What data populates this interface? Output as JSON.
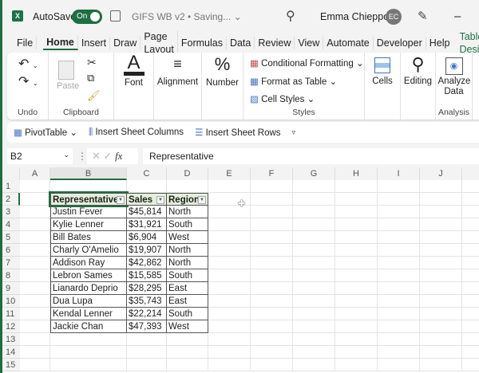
{
  "title": {
    "autosave": "AutoSave",
    "toggle": "On",
    "doc": "GIFS WB v2 • Saving... ⌄",
    "user": "Emma Chieppor",
    "initials": "EC"
  },
  "tabs": [
    "File",
    "Home",
    "Insert",
    "Draw",
    "Page Layout",
    "Formulas",
    "Data",
    "Review",
    "View",
    "Automate",
    "Developer",
    "Help",
    "Table Design"
  ],
  "ribbon": {
    "undo": "Undo",
    "paste": "Paste",
    "clipboard": "Clipboard",
    "font": "Font",
    "alignment": "Alignment",
    "number": "Number",
    "cond": "Conditional Formatting ⌄",
    "fmt_table": "Format as Table ⌄",
    "cell_styles": "Cell Styles ⌄",
    "styles": "Styles",
    "cells": "Cells",
    "editing": "Editing",
    "analyze": "Analyze Data",
    "analysis": "Analysis"
  },
  "qbar": {
    "pivot": "PivotTable ⌄",
    "ins_cols": "Insert Sheet Columns",
    "ins_rows": "Insert Sheet Rows"
  },
  "formula": {
    "namebox": "B2",
    "fx": "fx",
    "value": "Representative"
  },
  "columns": [
    "A",
    "B",
    "C",
    "D",
    "E",
    "F",
    "G",
    "H",
    "I",
    "J"
  ],
  "rows": [
    "1",
    "2",
    "3",
    "4",
    "5",
    "6",
    "7",
    "8",
    "9",
    "10",
    "11",
    "12",
    "13",
    "14",
    "15"
  ],
  "table": {
    "headers": [
      "Representative",
      "Sales",
      "Region"
    ],
    "rows": [
      [
        "Justin Fever",
        "$45,814",
        "North"
      ],
      [
        "Kylie Lenner",
        "$31,921",
        "South"
      ],
      [
        "Bill Bates",
        "$6,904",
        "West"
      ],
      [
        "Charly O'Amelio",
        "$19,907",
        "North"
      ],
      [
        "Addison Ray",
        "$42,862",
        "North"
      ],
      [
        "Lebron Sames",
        "$15,585",
        "South"
      ],
      [
        "Lianardo Deprio",
        "$28,295",
        "East"
      ],
      [
        "Dua Lupa",
        "$35,743",
        "East"
      ],
      [
        "Kendal Lenner",
        "$22,214",
        "South"
      ],
      [
        "Jackie Chan",
        "$47,393",
        "West"
      ]
    ]
  },
  "colors": {
    "accent": "#1e6e42",
    "header_fill": "#e2efda"
  }
}
